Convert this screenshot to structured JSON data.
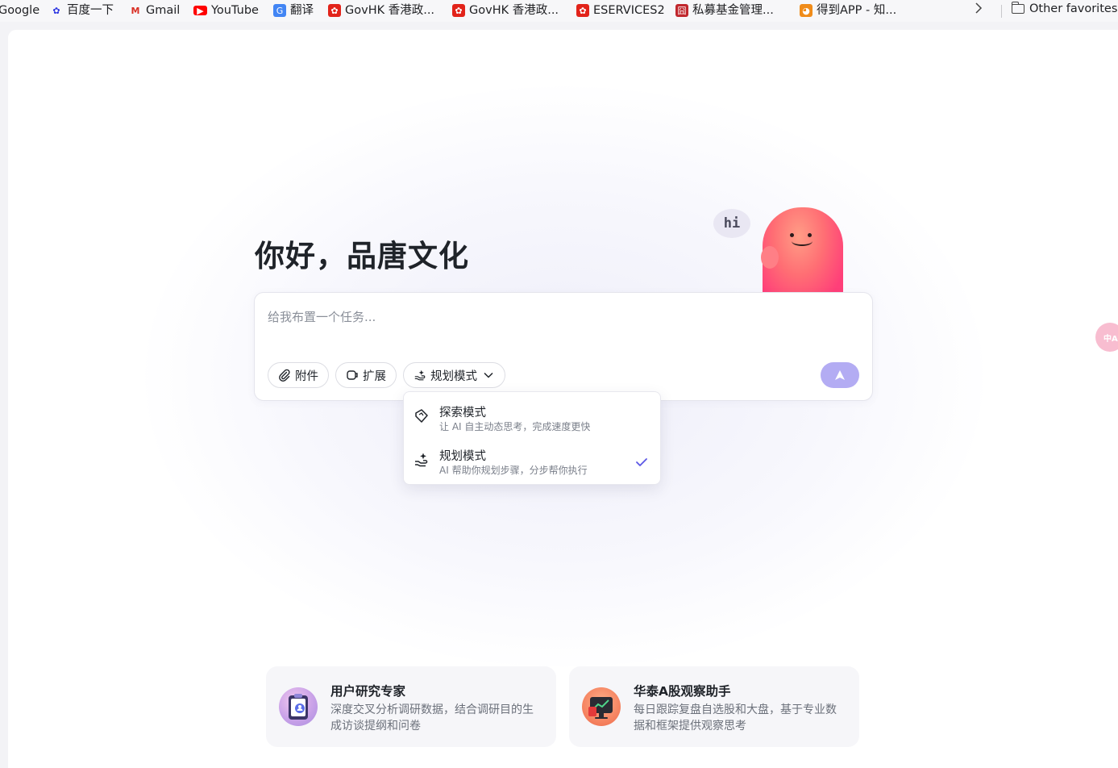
{
  "bookmarks": {
    "items": [
      {
        "label": "Google",
        "icon": "google-icon"
      },
      {
        "label": "百度一下",
        "icon": "baidu-icon"
      },
      {
        "label": "Gmail",
        "icon": "gmail-icon"
      },
      {
        "label": "YouTube",
        "icon": "youtube-icon"
      },
      {
        "label": "翻译",
        "icon": "translate-icon"
      },
      {
        "label": "GovHK 香港政...",
        "icon": "govhk-icon"
      },
      {
        "label": "GovHK 香港政...",
        "icon": "govhk-icon"
      },
      {
        "label": "ESERVICES2",
        "icon": "govhk-icon"
      },
      {
        "label": "私募基金管理...",
        "icon": "fund-icon"
      },
      {
        "label": "得到APP - 知...",
        "icon": "dedao-icon"
      }
    ],
    "more_icon": "chevron-right-icon",
    "folder_label": "Other favorites"
  },
  "main": {
    "greeting": "你好，品唐文化",
    "mascot_bubble": "hi",
    "composer": {
      "placeholder": "给我布置一个任务...",
      "attach_label": "附件",
      "extend_label": "扩展",
      "mode_label": "规划模式"
    },
    "mode_menu": [
      {
        "title": "探索模式",
        "desc": "让 AI 自主动态思考，完成速度更快",
        "selected": false
      },
      {
        "title": "规划模式",
        "desc": "AI 帮助你规划步骤，分步帮你执行",
        "selected": true
      }
    ],
    "agents": [
      {
        "title": "用户研究专家",
        "desc": "深度交叉分析调研数据，结合调研目的生成访谈提纲和问卷"
      },
      {
        "title": "华泰A股观察助手",
        "desc": "每日跟踪复盘自选股和大盘，基于专业数据和框架提供观察思考"
      }
    ],
    "side_badge": "中A"
  },
  "colors": {
    "accent": "#b3acf3",
    "check": "#5b57e6",
    "blob": "#ff5a78"
  }
}
